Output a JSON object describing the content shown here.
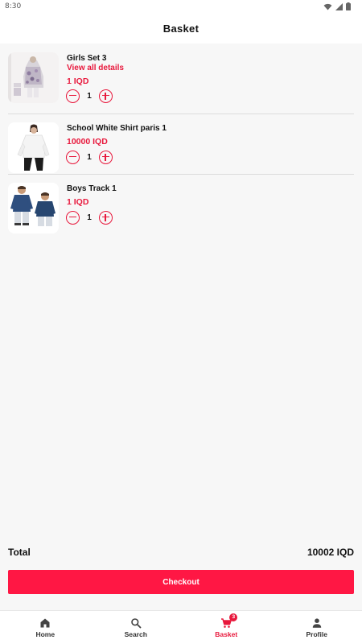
{
  "status_bar": {
    "time": "8:30"
  },
  "app_bar": {
    "title": "Basket"
  },
  "basket": {
    "items": [
      {
        "name": "Girls Set 3",
        "link": "View all details",
        "price": "1 IQD",
        "qty": "1"
      },
      {
        "name": "School White Shirt paris 1",
        "price": "10000 IQD",
        "qty": "1"
      },
      {
        "name": "Boys Track 1",
        "price": "1 IQD",
        "qty": "1"
      }
    ]
  },
  "summary": {
    "total_label": "Total",
    "total_value": "10002 IQD",
    "checkout_label": "Checkout"
  },
  "bottom_nav": {
    "items": [
      {
        "label": "Home",
        "icon": "home-icon"
      },
      {
        "label": "Search",
        "icon": "search-icon"
      },
      {
        "label": "Basket",
        "icon": "cart-icon",
        "badge": "3"
      },
      {
        "label": "Profile",
        "icon": "person-icon"
      }
    ]
  },
  "colors": {
    "accent": "#e8183c",
    "checkout": "#ff1744",
    "background": "#f7f7f7"
  }
}
